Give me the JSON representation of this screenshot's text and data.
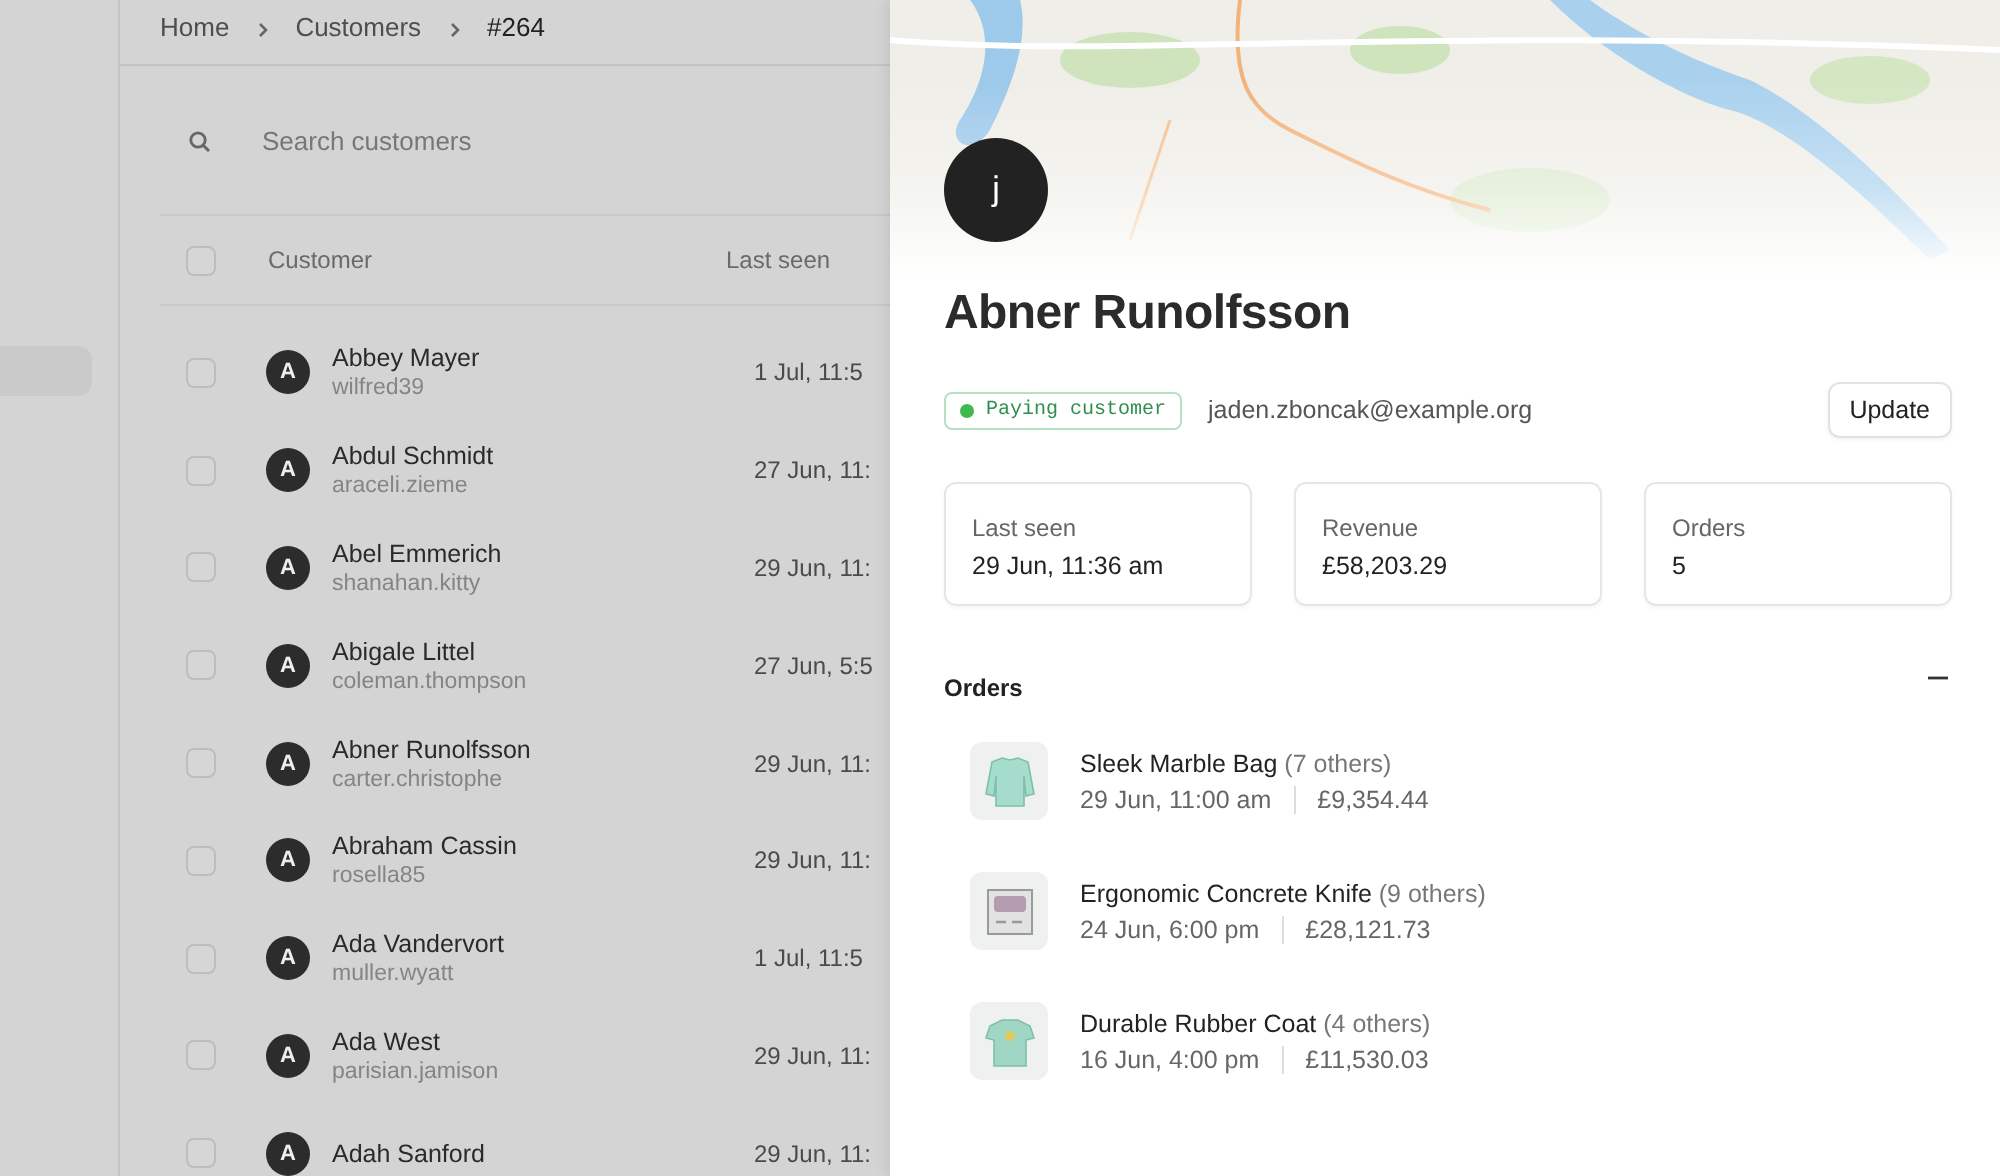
{
  "breadcrumb": [
    "Home",
    "Customers",
    "#264"
  ],
  "search": {
    "placeholder": "Search customers"
  },
  "table": {
    "select_all_checked": false,
    "columns": [
      "Customer",
      "Last seen"
    ],
    "rows": [
      {
        "initial": "A",
        "name": "Abbey Mayer",
        "username": "wilfred39",
        "last_seen": "1 Jul, 11:5",
        "checked": false
      },
      {
        "initial": "A",
        "name": "Abdul Schmidt",
        "username": "araceli.zieme",
        "last_seen": "27 Jun, 11:",
        "checked": false
      },
      {
        "initial": "A",
        "name": "Abel Emmerich",
        "username": "shanahan.kitty",
        "last_seen": "29 Jun, 11:",
        "checked": false
      },
      {
        "initial": "A",
        "name": "Abigale Littel",
        "username": "coleman.thompson",
        "last_seen": "27 Jun, 5:5",
        "checked": false
      },
      {
        "initial": "A",
        "name": "Abner Runolfsson",
        "username": "carter.christophe",
        "last_seen": "29 Jun, 11:",
        "checked": false
      },
      {
        "initial": "A",
        "name": "Abraham Cassin",
        "username": "rosella85",
        "last_seen": "29 Jun, 11:",
        "checked": false
      },
      {
        "initial": "A",
        "name": "Ada Vandervort",
        "username": "muller.wyatt",
        "last_seen": "1 Jul, 11:5",
        "checked": false
      },
      {
        "initial": "A",
        "name": "Ada West",
        "username": "parisian.jamison",
        "last_seen": "29 Jun, 11:",
        "checked": false
      },
      {
        "initial": "A",
        "name": "Adah Sanford",
        "last_seen": "29 Jun, 11:",
        "checked": false
      }
    ]
  },
  "panel": {
    "initial": "j",
    "name": "Abner Runolfsson",
    "status": {
      "label": "Paying customer",
      "color": "#3fb950"
    },
    "email": "jaden.zboncak@example.org",
    "action": "Update",
    "stats": [
      {
        "label": "Last seen",
        "value": "29 Jun, 11:36 am"
      },
      {
        "label": "Revenue",
        "value": "£58,203.29"
      },
      {
        "label": "Orders",
        "value": "5"
      }
    ],
    "orders_section": {
      "title": "Orders",
      "expanded": true
    },
    "orders": [
      {
        "kind": "sweater",
        "product": "Sleek Marble Bag",
        "others": "(7 others)",
        "date": "29 Jun, 11:00 am",
        "total": "£9,354.44"
      },
      {
        "kind": "sign",
        "product": "Ergonomic Concrete Knife",
        "others": "(9 others)",
        "date": "24 Jun, 6:00 pm",
        "total": "£28,121.73"
      },
      {
        "kind": "tshirt",
        "product": "Durable Rubber Coat",
        "others": "(4 others)",
        "date": "16 Jun, 4:00 pm",
        "total": "£11,530.03"
      }
    ]
  }
}
